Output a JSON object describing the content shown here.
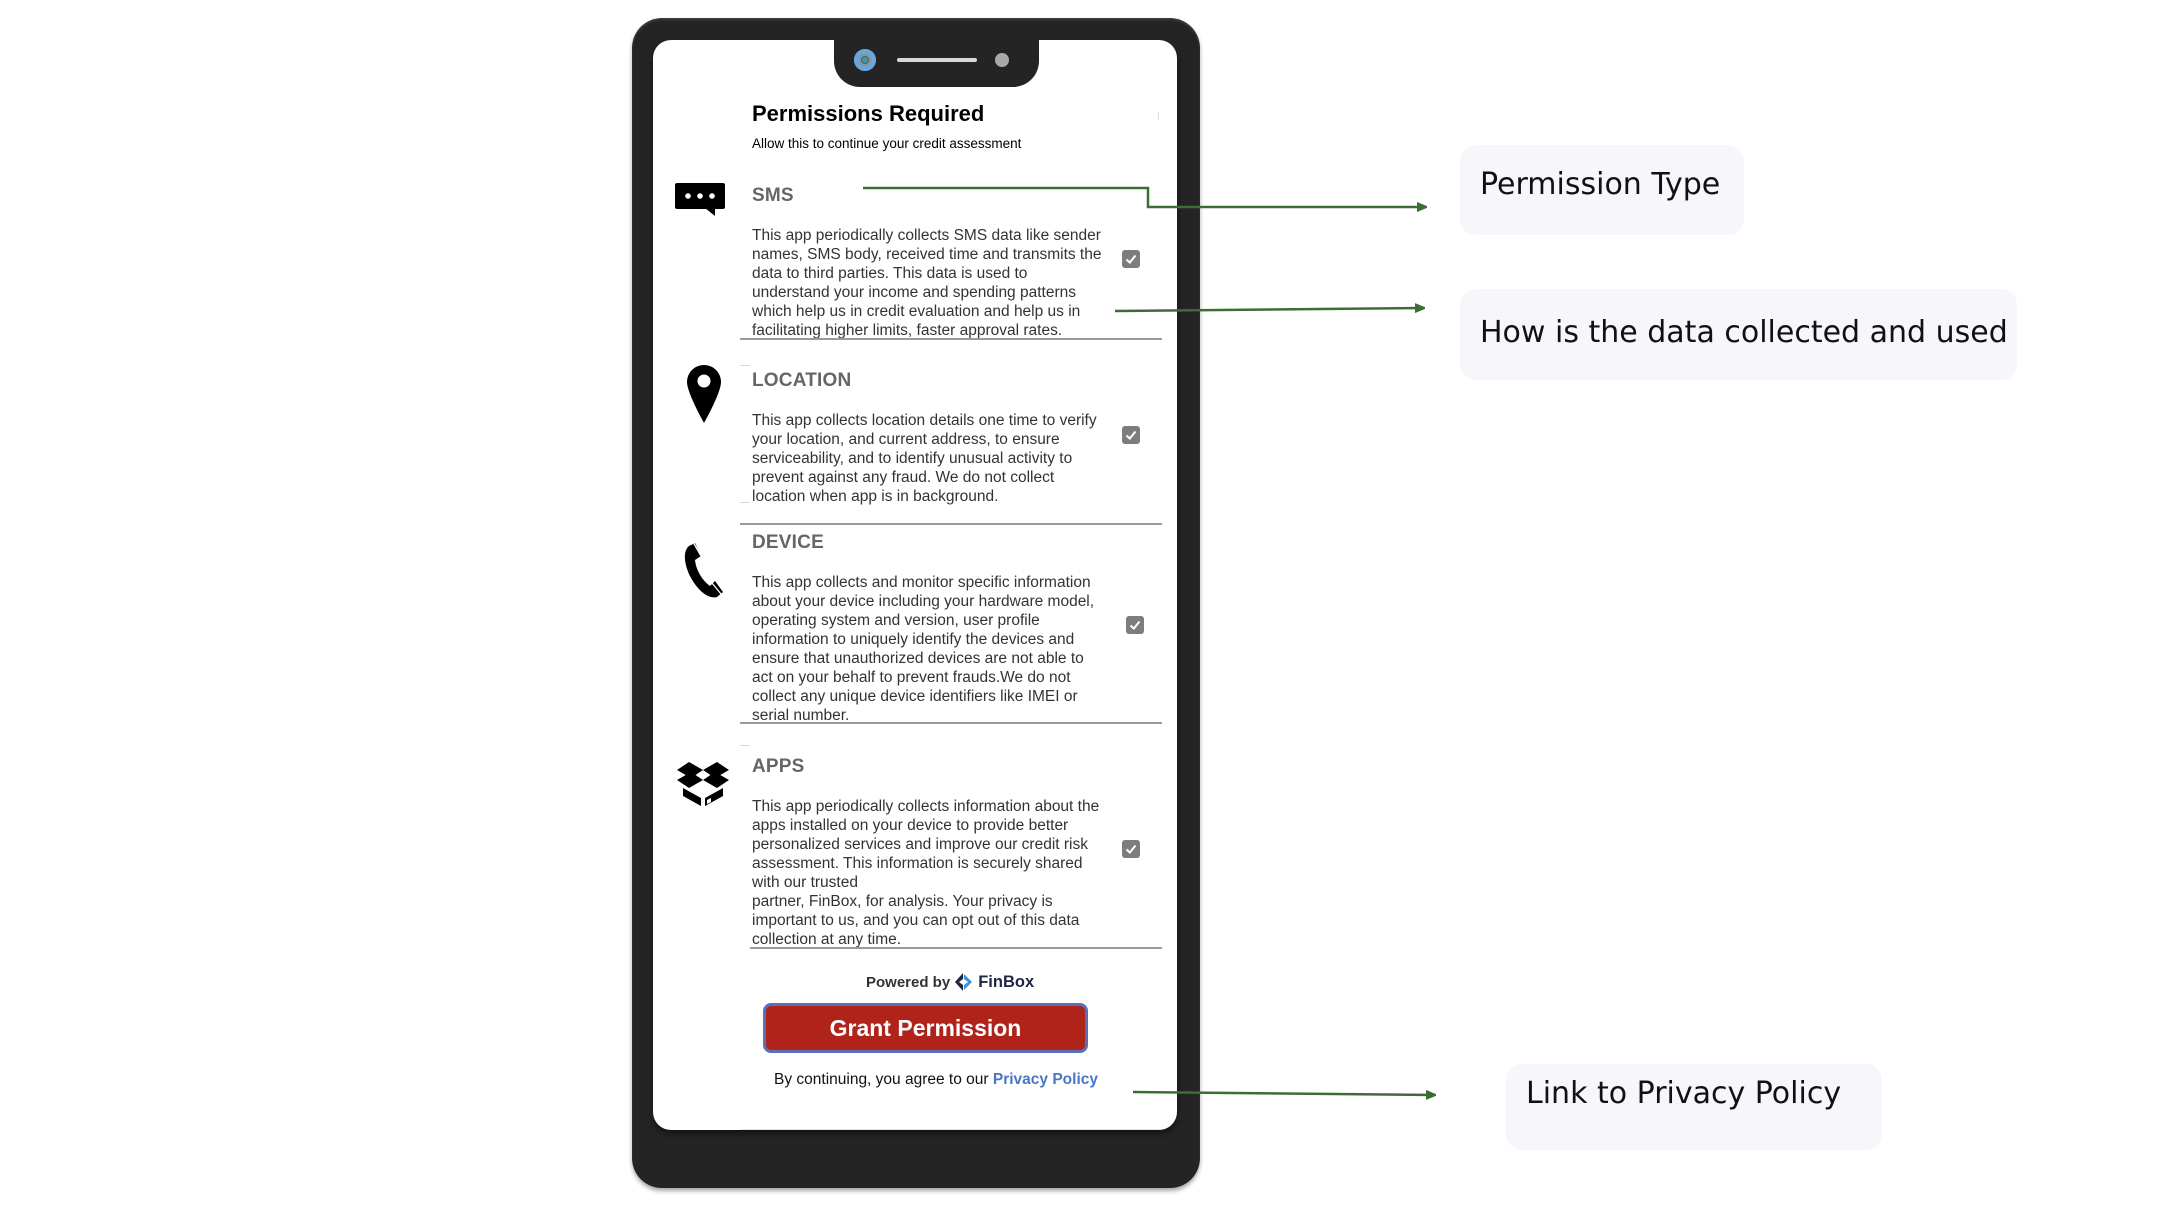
{
  "screen": {
    "title": "Permissions Required",
    "subtitle": "Allow this to continue your credit assessment",
    "permissions": [
      {
        "label": "SMS",
        "icon": "sms-chat-bubble-icon",
        "checked": true,
        "description_lines": [
          "This app periodically collects SMS data like sender",
          "names, SMS body, received time and transmits the",
          "data to third parties. This data is used to",
          "understand your income and spending patterns",
          "which help us in credit evaluation and help us in",
          "facilitating higher limits, faster approval rates."
        ]
      },
      {
        "label": "LOCATION",
        "icon": "location-pin-icon",
        "checked": true,
        "description_lines": [
          "This app collects location details one time to verify",
          "your location, and current address, to ensure",
          "serviceability, and to identify unusual activity to",
          "prevent against any fraud. We do not collect",
          "location when app is in background."
        ]
      },
      {
        "label": "DEVICE",
        "icon": "phone-handset-icon",
        "checked": true,
        "description_lines": [
          "This app collects and monitor specific information",
          "about your device including your hardware model,",
          "operating system and version, user profile",
          "information to uniquely identify the devices and",
          "ensure that unauthorized devices are not able to",
          "act on your behalf to prevent frauds.We do not",
          "collect any unique device identifiers like IMEI or",
          "serial number."
        ]
      },
      {
        "label": "APPS",
        "icon": "open-box-icon",
        "checked": true,
        "description_lines": [
          "This app periodically collects information about the",
          "apps installed on your device to provide better",
          "personalized services and improve our credit risk",
          "assessment. This information is securely shared",
          "with our trusted",
          "partner, FinBox, for analysis. Your privacy is",
          "important to us, and you can opt out of this data",
          "collection at any time."
        ]
      }
    ],
    "powered_by": "Powered by",
    "brand": "FinBox",
    "grant_button": "Grant Permission",
    "agree_text": "By continuing, you agree to our ",
    "privacy_link": "Privacy Policy"
  },
  "annotations": [
    {
      "label": "Permission Type"
    },
    {
      "label": "How is the data collected and used"
    },
    {
      "label": "Link to Privacy Policy"
    }
  ],
  "colors": {
    "button_red": "#b0231b",
    "button_border": "#5b6fb4",
    "link_blue": "#4a76c4",
    "arrow_green": "#3b6e33",
    "callout_bg": "#f7f7fb",
    "phone_frame": "#242424"
  }
}
